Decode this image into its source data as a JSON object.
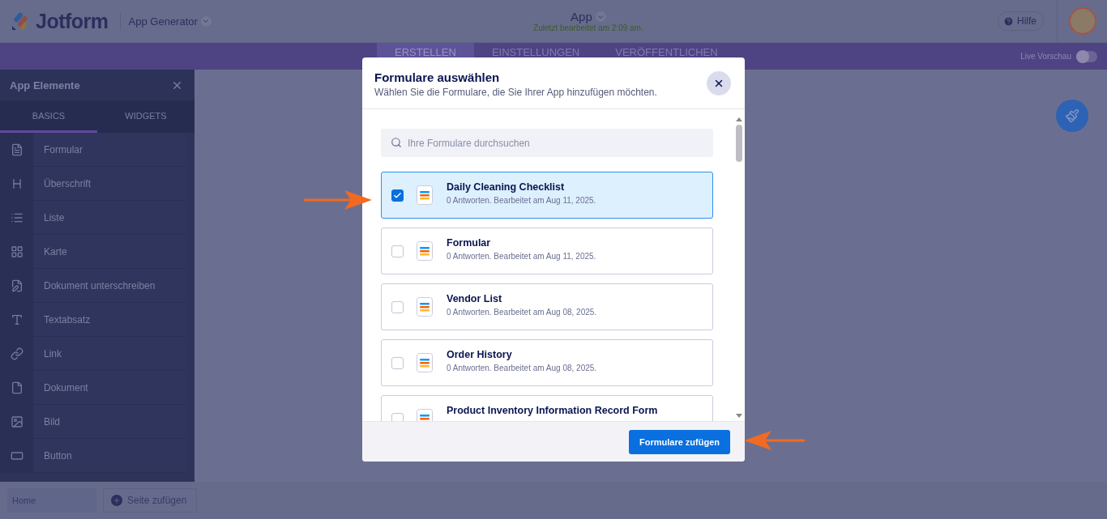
{
  "header": {
    "brand": "Jotform",
    "product": "App Generator",
    "app_title": "App",
    "last_edited": "Zuletzt bearbeitet am 2:09 am.",
    "help": "Hilfe"
  },
  "nav_tabs": [
    {
      "label": "ERSTELLEN",
      "selected": true
    },
    {
      "label": "EINSTELLUNGEN",
      "selected": false
    },
    {
      "label": "VERÖFFENTLICHEN",
      "selected": false
    }
  ],
  "live_preview": {
    "label": "Live Vorschau",
    "on": false
  },
  "sidebar": {
    "title": "App Elemente",
    "tabs": [
      {
        "label": "BASICS",
        "selected": true
      },
      {
        "label": "WIDGETS",
        "selected": false
      }
    ],
    "items": [
      {
        "label": "Formular"
      },
      {
        "label": "Überschrift"
      },
      {
        "label": "Liste"
      },
      {
        "label": "Karte"
      },
      {
        "label": "Dokument unterschreiben"
      },
      {
        "label": "Textabsatz"
      },
      {
        "label": "Link"
      },
      {
        "label": "Dokument"
      },
      {
        "label": "Bild"
      },
      {
        "label": "Button"
      }
    ]
  },
  "bottom_bar": {
    "page": "Home",
    "add_page": "Seite zufügen"
  },
  "modal": {
    "title": "Formulare auswählen",
    "subtitle": "Wählen Sie die Formulare, die Sie Ihrer App hinzufügen möchten.",
    "search": {
      "placeholder": "Ihre Formulare durchsuchen"
    },
    "forms": [
      {
        "name": "Daily Cleaning Checklist",
        "meta": "0 Antworten. Bearbeitet am Aug 11, 2025.",
        "selected": true
      },
      {
        "name": "Formular",
        "meta": "0 Antworten. Bearbeitet am Aug 11, 2025.",
        "selected": false
      },
      {
        "name": "Vendor List",
        "meta": "0 Antworten. Bearbeitet am Aug 08, 2025.",
        "selected": false
      },
      {
        "name": "Order History",
        "meta": "0 Antworten. Bearbeitet am Aug 08, 2025.",
        "selected": false
      },
      {
        "name": "Product Inventory Information Record Form",
        "selected": false
      }
    ],
    "submit": "Formulare zufügen"
  }
}
